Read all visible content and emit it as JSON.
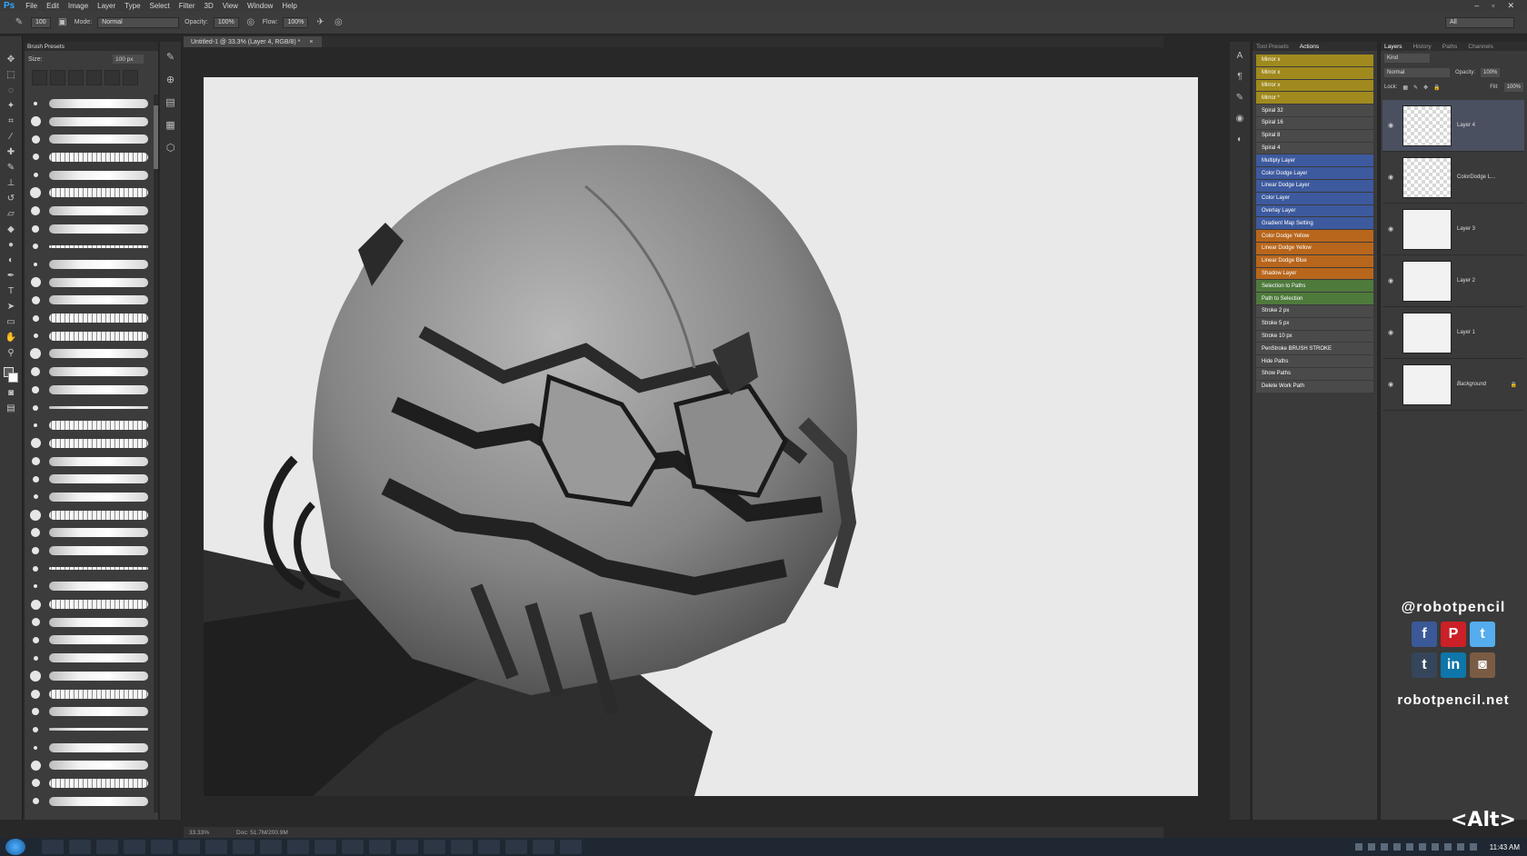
{
  "app": {
    "logo": "Ps"
  },
  "menu": [
    "File",
    "Edit",
    "Image",
    "Layer",
    "Type",
    "Select",
    "Filter",
    "3D",
    "View",
    "Window",
    "Help"
  ],
  "window_controls": {
    "minimize": "–",
    "restore": "▫",
    "close": "✕"
  },
  "options": {
    "brush_size": "100",
    "mode_label": "Mode:",
    "mode_value": "Normal",
    "opacity_label": "Opacity:",
    "opacity_value": "100%",
    "flow_label": "Flow:",
    "flow_value": "100%",
    "workspace_value": "All"
  },
  "brush_panel": {
    "title": "Brush Presets",
    "size_label": "Size:",
    "size_value": "100 px"
  },
  "document": {
    "tab_title": "Untitled-1 @ 33.3% (Layer 4, RGB/8) *",
    "tab_close": "×",
    "zoom": "33.33%",
    "doc_info": "Doc: 51.7M/200.9M"
  },
  "actions_panel": {
    "tabs": [
      "Tool Presets",
      "Actions"
    ],
    "items": [
      {
        "label": "Mirror x",
        "color": "#a08a1e"
      },
      {
        "label": "Mirror x",
        "color": "#a08a1e"
      },
      {
        "label": "Mirror x",
        "color": "#a08a1e"
      },
      {
        "label": "Mirror *",
        "color": "#a08a1e"
      },
      {
        "label": "Spiral 32",
        "color": "#4a4a4a"
      },
      {
        "label": "Spiral 16",
        "color": "#4a4a4a"
      },
      {
        "label": "Spiral 8",
        "color": "#4a4a4a"
      },
      {
        "label": "Spiral 4",
        "color": "#4a4a4a"
      },
      {
        "label": "Multiply Layer",
        "color": "#3d5a9e"
      },
      {
        "label": "Color Dodge Layer",
        "color": "#3d5a9e"
      },
      {
        "label": "Linear Dodge Layer",
        "color": "#3d5a9e"
      },
      {
        "label": "Color Layer",
        "color": "#3d5a9e"
      },
      {
        "label": "Overlay Layer",
        "color": "#3d5a9e"
      },
      {
        "label": "Gradient Map Setting",
        "color": "#3d5a9e"
      },
      {
        "label": "Color Dodge Yellow",
        "color": "#b8661c"
      },
      {
        "label": "Linear Dodge Yellow",
        "color": "#b8661c"
      },
      {
        "label": "Linear Dodge Blue",
        "color": "#b8661c"
      },
      {
        "label": "Shadow Layer",
        "color": "#b8661c"
      },
      {
        "label": "Selection to Paths",
        "color": "#4e7a3c"
      },
      {
        "label": "Path to Selection",
        "color": "#4e7a3c"
      },
      {
        "label": "Stroke 2 px",
        "color": "#4a4a4a"
      },
      {
        "label": "Stroke 5 px",
        "color": "#4a4a4a"
      },
      {
        "label": "Stroke 10 px",
        "color": "#4a4a4a"
      },
      {
        "label": "PenStroke BRUSH STROKE",
        "color": "#4a4a4a"
      },
      {
        "label": "Hide Paths",
        "color": "#4a4a4a"
      },
      {
        "label": "Show Paths",
        "color": "#4a4a4a"
      },
      {
        "label": "Delete Work Path",
        "color": "#4a4a4a"
      }
    ]
  },
  "layers_panel": {
    "tabs": [
      "Layers",
      "History",
      "Paths",
      "Channels"
    ],
    "kind_label": "Kind",
    "blend_mode": "Normal",
    "opacity_label": "Opacity:",
    "opacity_value": "100%",
    "lock_label": "Lock:",
    "fill_label": "Fill:",
    "fill_value": "100%",
    "layers": [
      {
        "name": "Layer 4",
        "selected": true
      },
      {
        "name": "ColorDodge L...",
        "selected": false
      },
      {
        "name": "Layer 3",
        "selected": false
      },
      {
        "name": "Layer 2",
        "selected": false
      },
      {
        "name": "Layer 1",
        "selected": false
      },
      {
        "name": "Background",
        "selected": false
      }
    ]
  },
  "branding": {
    "handle": "@robotpencil",
    "website": "robotpencil.net",
    "alt_logo": "<Alt>",
    "social": [
      {
        "icon": "facebook-icon",
        "glyph": "f",
        "color": "#3b5998"
      },
      {
        "icon": "pinterest-icon",
        "glyph": "P",
        "color": "#cb2027"
      },
      {
        "icon": "twitter-icon",
        "glyph": "t",
        "color": "#55acee"
      },
      {
        "icon": "tumblr-icon",
        "glyph": "t",
        "color": "#35465c"
      },
      {
        "icon": "linkedin-icon",
        "glyph": "in",
        "color": "#0e76a8"
      },
      {
        "icon": "instagram-icon",
        "glyph": "◙",
        "color": "#7a5c44"
      }
    ]
  },
  "taskbar": {
    "clock": "11:43 AM"
  },
  "colors": {
    "accent_layer_fx": "#a08a1e",
    "selection": "#4a5060"
  }
}
